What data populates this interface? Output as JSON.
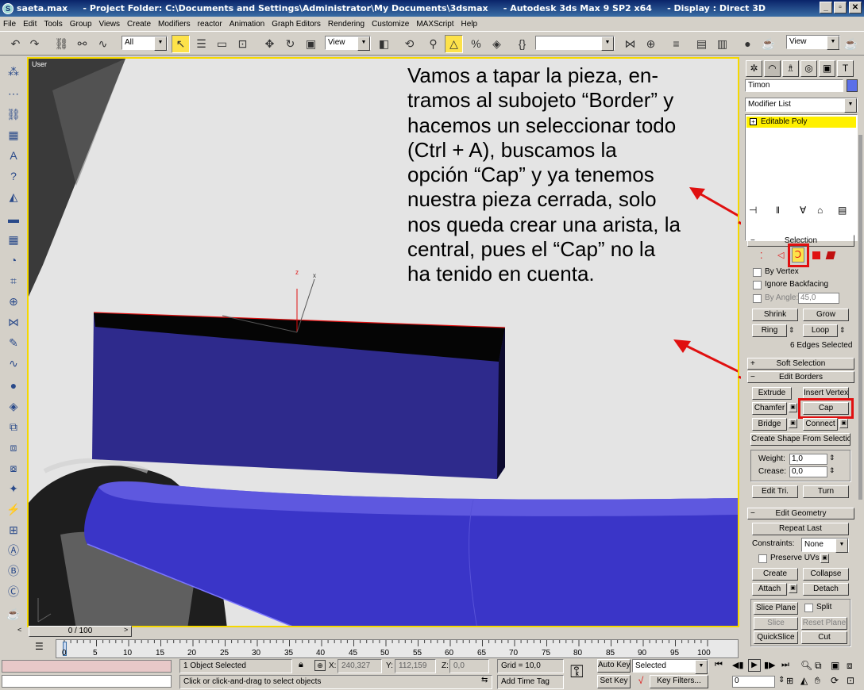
{
  "window": {
    "title": "saeta.max     - Project Folder: C:\\Documents and Settings\\Administrator\\My Documents\\3dsmax     - Autodesk 3ds Max 9 SP2 x64     - Display : Direct 3D",
    "minimize": "_",
    "restore": "▫",
    "close": "✕"
  },
  "menu": [
    "File",
    "Edit",
    "Tools",
    "Group",
    "Views",
    "Create",
    "Modifiers",
    "reactor",
    "Animation",
    "Graph Editors",
    "Rendering",
    "Customize",
    "MAXScript",
    "Help"
  ],
  "toolbar": {
    "selection_filter": "All",
    "reference_coord": "View",
    "named_selection": "",
    "view_dropdown": "View"
  },
  "viewport": {
    "label": "User",
    "annotation": [
      "Vamos a tapar la pieza, en-",
      "tramos al subojeto “Border” y",
      "hacemos un seleccionar todo",
      "(Ctrl + A), buscamos la",
      "opción “Cap” y ya tenemos",
      "nuestra pieza cerrada, solo",
      "nos queda crear una arista, la",
      "central, pues el “Cap” no la",
      "ha tenido en cuenta."
    ],
    "accent_red": "#e01010",
    "object_color": "#2e2a8c"
  },
  "command_panel": {
    "object_name": "Timon",
    "modifier_list": "Modifier List",
    "stack_item": "Editable Poly",
    "selection": {
      "title": "Selection",
      "by_vertex": "By Vertex",
      "ignore_backfacing": "Ignore Backfacing",
      "by_angle": "By Angle:",
      "angle_value": "45,0",
      "shrink": "Shrink",
      "grow": "Grow",
      "ring": "Ring",
      "loop": "Loop",
      "status": "6 Edges Selected"
    },
    "soft_selection": "Soft Selection",
    "edit_borders": {
      "title": "Edit Borders",
      "extrude": "Extrude",
      "insert_vertex": "Insert Vertex",
      "chamfer": "Chamfer",
      "cap": "Cap",
      "bridge": "Bridge",
      "connect": "Connect",
      "create_shape": "Create Shape From Selection",
      "weight_label": "Weight:",
      "weight_value": "1,0",
      "crease_label": "Crease:",
      "crease_value": "0,0",
      "edit_tri": "Edit Tri.",
      "turn": "Turn"
    },
    "edit_geometry": {
      "title": "Edit Geometry",
      "repeat_last": "Repeat Last",
      "constraints_label": "Constraints:",
      "constraints_value": "None",
      "preserve_uvs": "Preserve UVs",
      "create": "Create",
      "collapse": "Collapse",
      "attach": "Attach",
      "detach": "Detach",
      "slice_plane": "Slice Plane",
      "split": "Split",
      "slice": "Slice",
      "reset_plane": "Reset Plane",
      "quickslice": "QuickSlice",
      "cut": "Cut"
    }
  },
  "timeline": {
    "frame_display": "0 / 100",
    "ticks": [
      "0",
      "5",
      "10",
      "15",
      "20",
      "25",
      "30",
      "35",
      "40",
      "45",
      "50",
      "55",
      "60",
      "65",
      "70",
      "75",
      "80",
      "85",
      "90",
      "95",
      "100"
    ]
  },
  "status": {
    "objects_selected": "1 Object Selected",
    "prompt": "Click or click-and-drag to select objects",
    "x_label": "X:",
    "x_value": "240,327",
    "y_label": "Y:",
    "y_value": "112,159",
    "z_label": "Z:",
    "z_value": "0,0",
    "grid": "Grid = 10,0",
    "add_time_tag": "Add Time Tag",
    "auto_key": "Auto Key",
    "selected": "Selected",
    "set_key": "Set Key",
    "key_filters": "Key Filters...",
    "frame": "0"
  }
}
